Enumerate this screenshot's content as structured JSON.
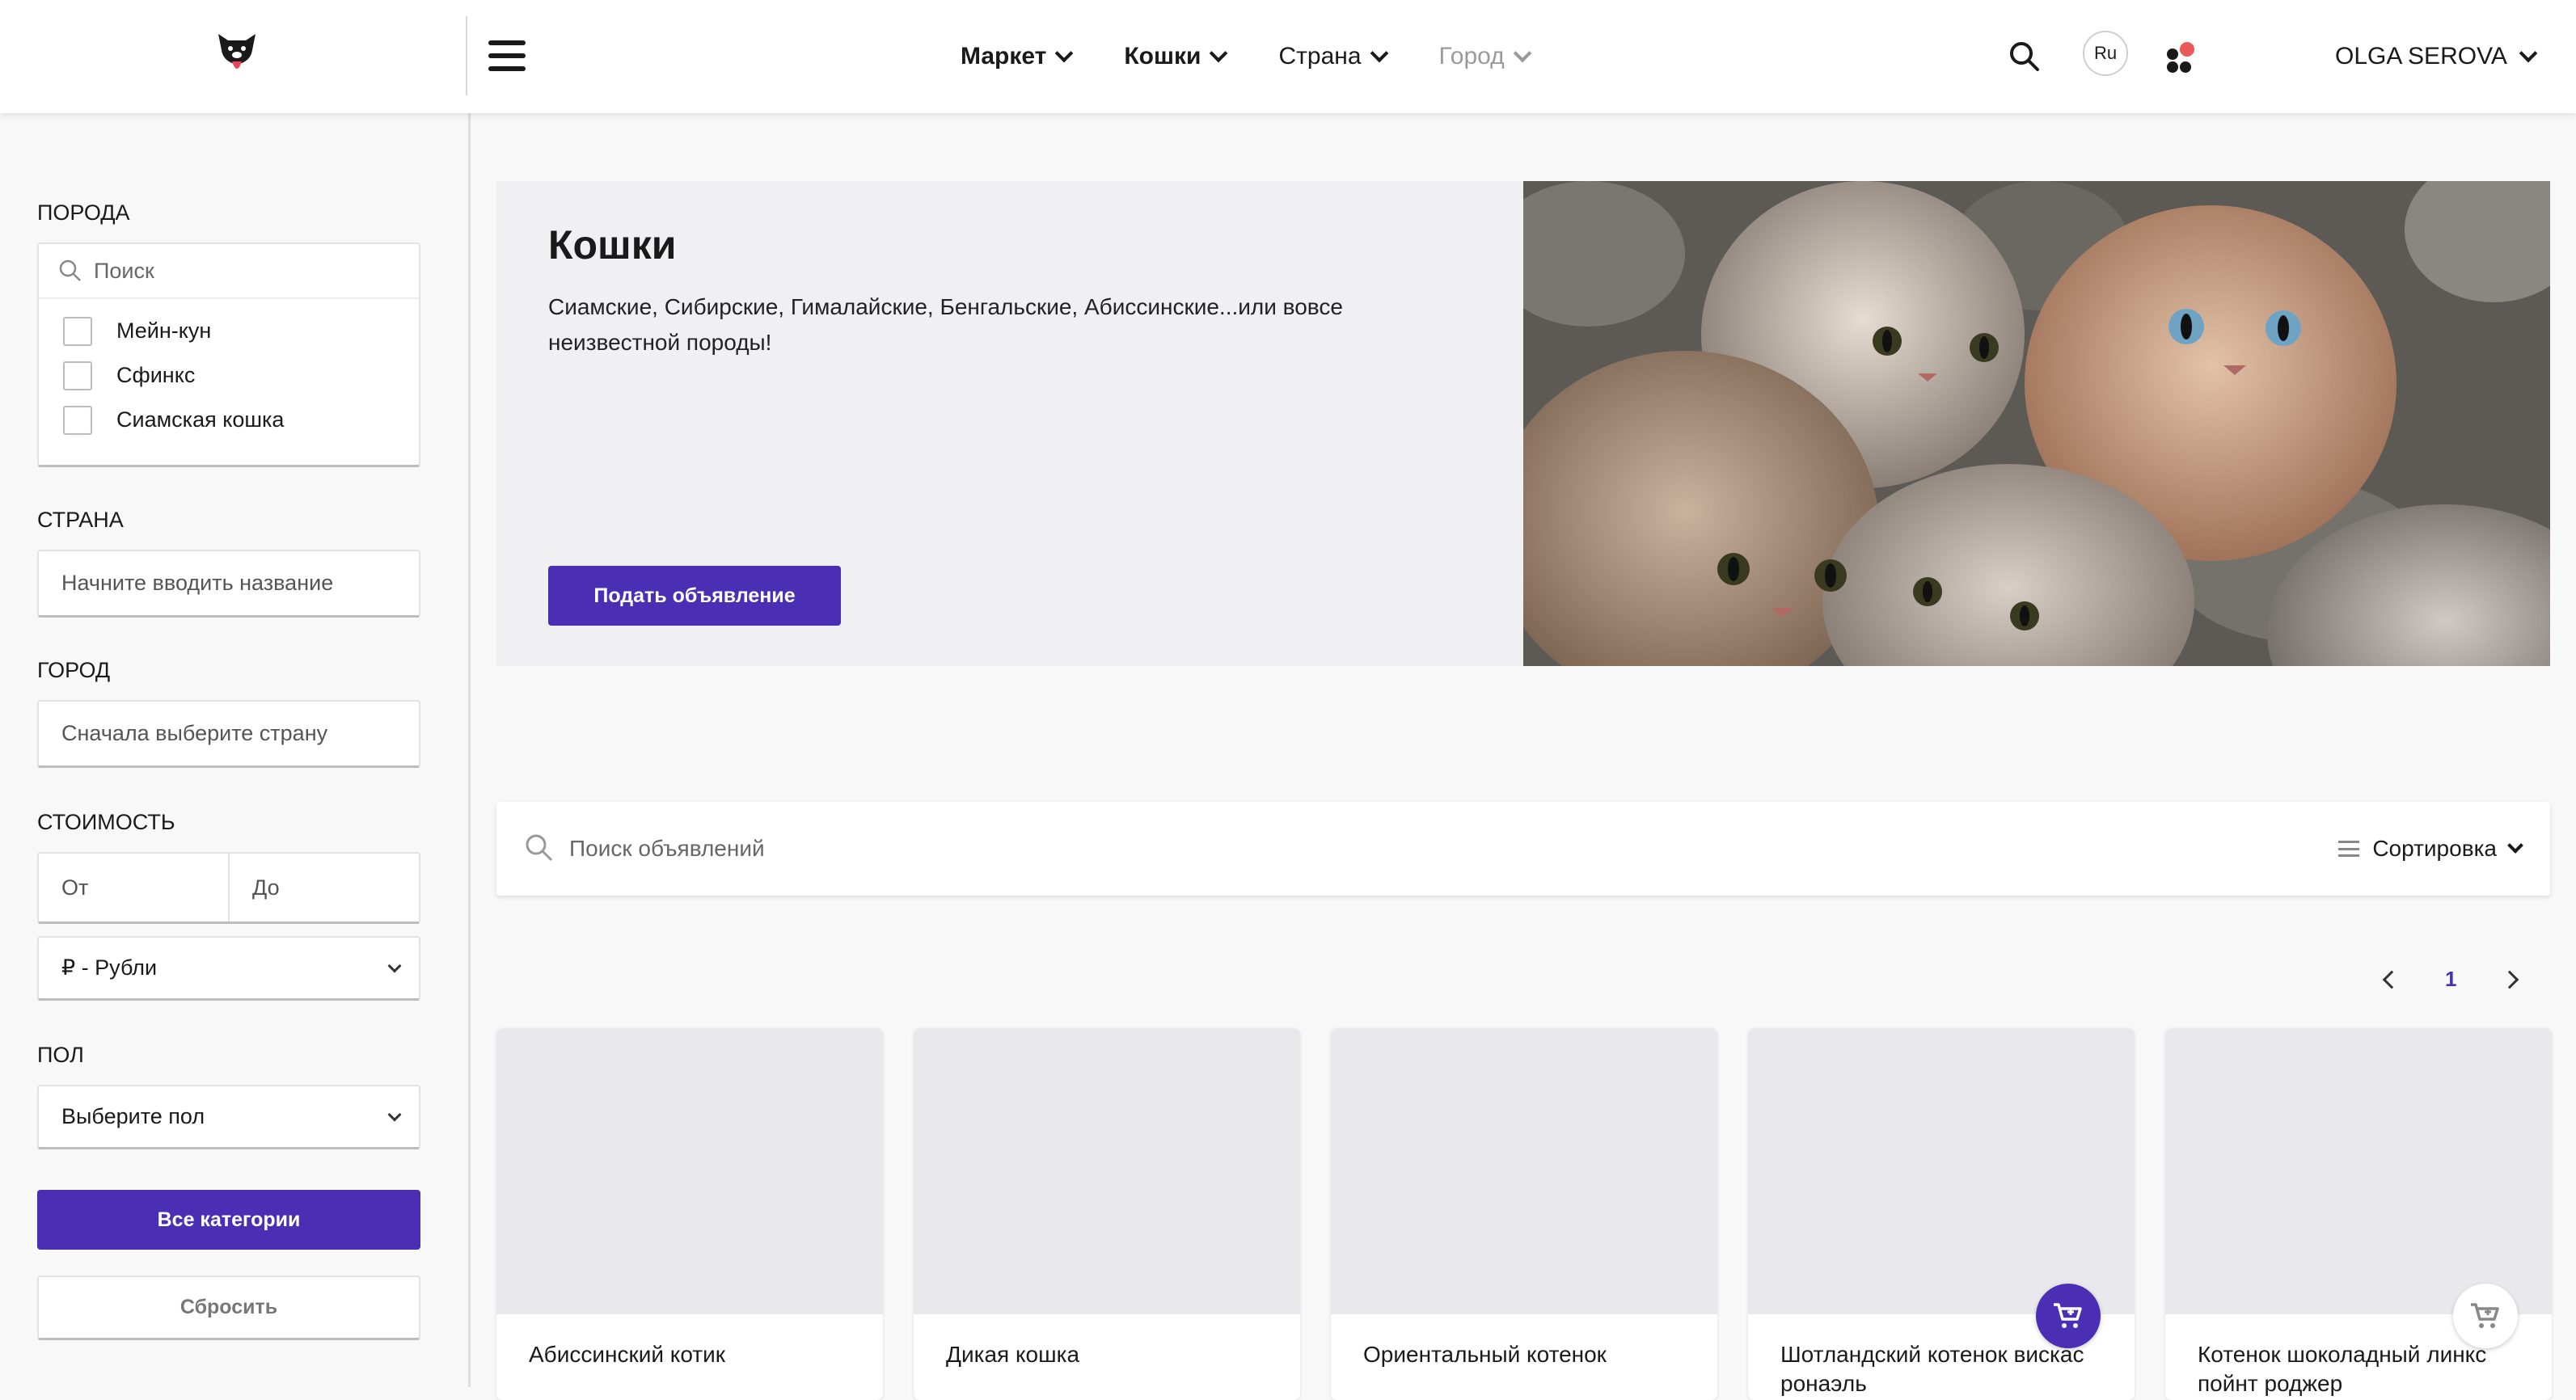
{
  "header": {
    "nav": [
      {
        "label": "Маркет",
        "style": "bold"
      },
      {
        "label": "Кошки",
        "style": "bold"
      },
      {
        "label": "Страна",
        "style": "normal"
      },
      {
        "label": "Город",
        "style": "dim"
      }
    ],
    "lang": "Ru",
    "user": "OLGA SEROVA"
  },
  "sidebar": {
    "breed_label": "ПОРОДА",
    "breed_search_placeholder": "Поиск",
    "breeds": [
      "Мейн-кун",
      "Сфинкс",
      "Сиамская кошка"
    ],
    "country_label": "СТРАНА",
    "country_placeholder": "Начните вводить название",
    "city_label": "ГОРОД",
    "city_placeholder": "Сначала выберите страну",
    "price_label": "СТОИМОСТЬ",
    "price_from": "От",
    "price_to": "До",
    "currency": "₽ - Рубли",
    "gender_label": "ПОЛ",
    "gender_placeholder": "Выберите пол",
    "all_categories": "Все категории",
    "reset": "Сбросить"
  },
  "hero": {
    "title": "Кошки",
    "text": "Сиамские, Сибирские, Гималайские, Бенгальские, Абиссинские...или вовсе неизвестной породы!",
    "button": "Подать объявление"
  },
  "listing": {
    "search_placeholder": "Поиск объявлений",
    "sort_label": "Сортировка",
    "page": "1"
  },
  "cards": [
    {
      "title": "Абиссинский котик"
    },
    {
      "title": "Дикая кошка"
    },
    {
      "title": "Ориентальный котенок"
    },
    {
      "title": "Шотландский котенок вискас ронаэль"
    },
    {
      "title": "Котенок шоколадный линкс пойнт роджер"
    }
  ],
  "colors": {
    "accent": "#4a2fb5",
    "notification": "#e85a5a"
  }
}
